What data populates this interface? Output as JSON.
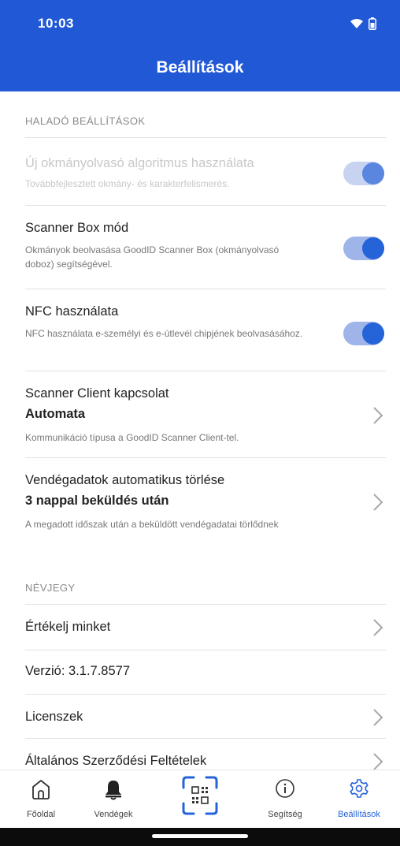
{
  "status": {
    "time": "10:03"
  },
  "header": {
    "title": "Beállítások"
  },
  "sections": {
    "advanced_label": "HALADÓ BEÁLLÍTÁSOK",
    "about_label": "NÉVJEGY"
  },
  "settings": {
    "new_algorithm": {
      "title": "Új okmányolvasó algoritmus használata",
      "description": "Továbbfejlesztett okmány- és karakterfelismerés.",
      "enabled": true,
      "disabled": true
    },
    "scanner_box": {
      "title": "Scanner Box mód",
      "description": "Okmányok beolvasása GoodID Scanner Box (okmányolvasó doboz) segítségével.",
      "enabled": true
    },
    "nfc": {
      "title": "NFC használata",
      "description": "NFC használata e-személyi és e-útlevél chipjének beolvasásához.",
      "enabled": true
    },
    "scanner_client": {
      "title": "Scanner Client kapcsolat",
      "value": "Automata",
      "description": "Kommunikáció típusa a GoodID Scanner Client-tel."
    },
    "guest_data_deletion": {
      "title": "Vendégadatok automatikus törlése",
      "value": "3 nappal beküldés után",
      "description": "A megadott időszak után a beküldött vendégadatai törlődnek"
    }
  },
  "about": {
    "rate_us": "Értékelj minket",
    "version": "Verzió: 3.1.7.8577",
    "licenses": "Licenszek",
    "terms": "Általános Szerződési Feltételek"
  },
  "tabbar": {
    "items": [
      {
        "label": "Főoldal",
        "icon": "home-icon"
      },
      {
        "label": "Vendégek",
        "icon": "bell-icon"
      },
      {
        "label": "",
        "icon": "scan-icon"
      },
      {
        "label": "Segítség",
        "icon": "info-icon"
      },
      {
        "label": "Beállítások",
        "icon": "gear-icon",
        "active": true
      }
    ]
  },
  "colors": {
    "header_bg": "#2158d6",
    "accent": "#2563d8",
    "toggle_track": "#9fb4e9"
  }
}
